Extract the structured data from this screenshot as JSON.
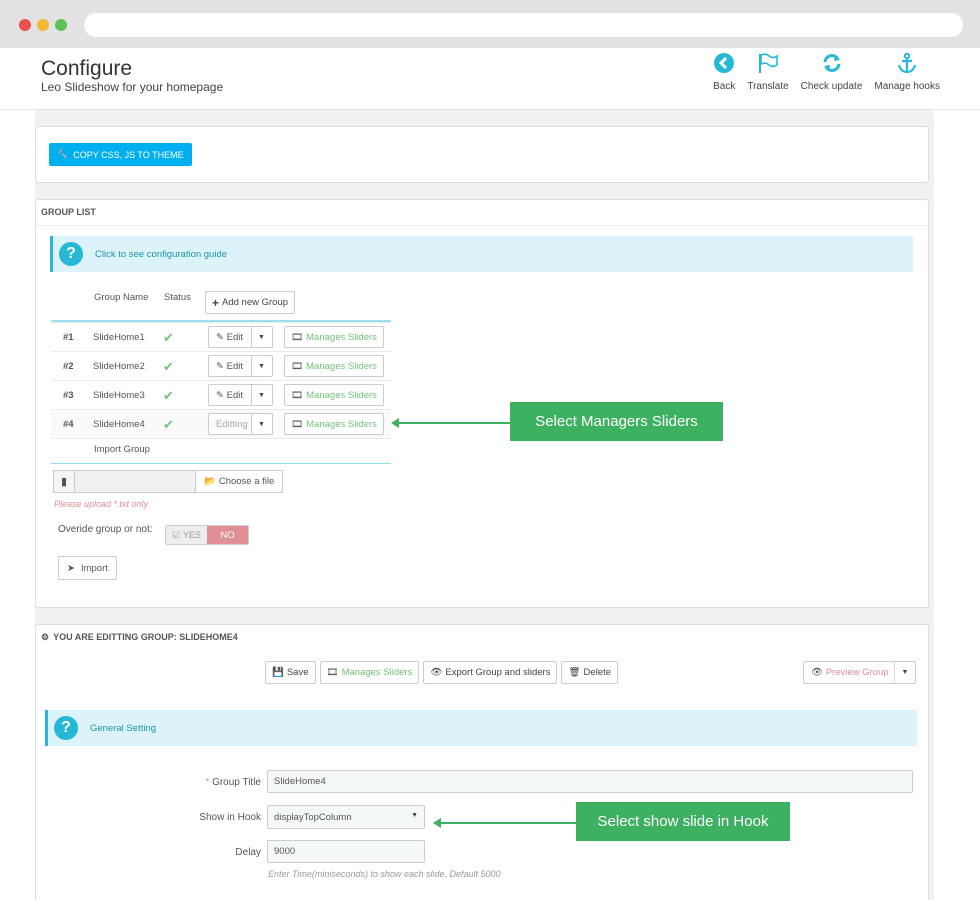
{
  "header": {
    "title": "Configure",
    "subtitle": "Leo Slideshow for your homepage",
    "toolbar": [
      {
        "label": "Back",
        "icon": "back-icon"
      },
      {
        "label": "Translate",
        "icon": "flag-icon"
      },
      {
        "label": "Check update",
        "icon": "refresh-icon"
      },
      {
        "label": "Manage hooks",
        "icon": "anchor-icon"
      }
    ]
  },
  "copy_button": "COPY CSS, JS TO THEME",
  "group_list": {
    "heading": "GROUP LIST",
    "guide": "Click to see configuration guide",
    "columns": {
      "name": "Group Name",
      "status": "Status"
    },
    "add_button": "Add new Group",
    "rows": [
      {
        "num": "#1",
        "name": "SlideHome1",
        "action": "Edit",
        "manage": "Manages Sliders"
      },
      {
        "num": "#2",
        "name": "SlideHome2",
        "action": "Edit",
        "manage": "Manages Sliders"
      },
      {
        "num": "#3",
        "name": "SlideHome3",
        "action": "Edit",
        "manage": "Manages Sliders"
      },
      {
        "num": "#4",
        "name": "SlideHome4",
        "action": "Editting",
        "manage": "Manages Sliders"
      }
    ],
    "import_label": "Import Group",
    "choose_file": "Choose a file",
    "upload_hint": "Please upload *.txt only",
    "override_label": "Overide group or not:",
    "yes": "YES",
    "no": "NO",
    "import_button": "Import"
  },
  "callouts": {
    "managers": "Select Managers Sliders",
    "hook": "Select show slide in Hook"
  },
  "editing": {
    "heading": "YOU ARE EDITTING GROUP: SLIDEHOME4",
    "save": "Save",
    "manage": "Manages Sliders",
    "export": "Export Group and sliders",
    "delete": "Delete",
    "preview": "Preview Group",
    "general": "General Setting",
    "fields": {
      "title_label": "Group Title",
      "title_value": "SlideHome4",
      "hook_label": "Show in Hook",
      "hook_value": "displayTopColumn",
      "delay_label": "Delay",
      "delay_value": "9000",
      "delay_help": "Enter Time(miniseconds) to show each slide. Default 5000"
    }
  },
  "colors": {
    "accent": "#25b9d7",
    "primary": "#00aff0",
    "success": "#72c279",
    "callout": "#3db160",
    "danger": "#e08f95"
  }
}
